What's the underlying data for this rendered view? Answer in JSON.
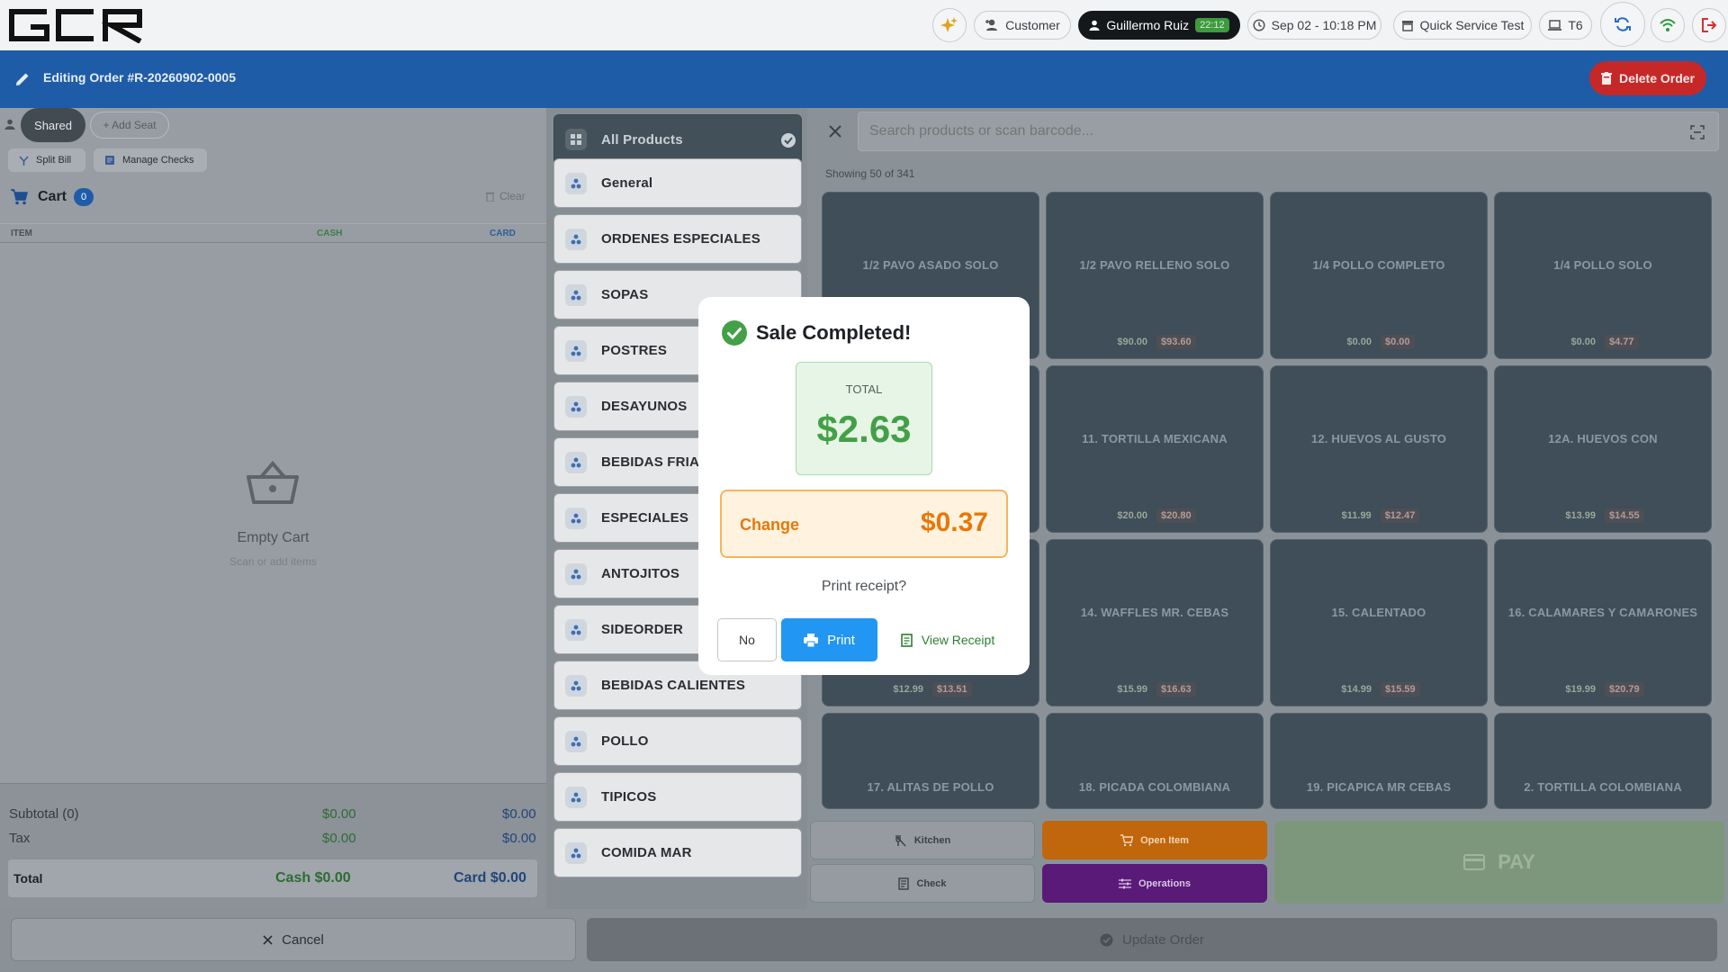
{
  "topbar": {
    "logo": "GCR",
    "customer_label": "Customer",
    "user_name": "Guillermo Ruiz",
    "user_timer": "22:12",
    "datetime": "Sep 02 - 10:18 PM",
    "store": "Quick Service Test",
    "table": "T6"
  },
  "editbar": {
    "title": "Editing Order #R-20260902-0005",
    "delete_label": "Delete Order"
  },
  "seats": {
    "shared_label": "Shared",
    "add_seat_label": "+ Add Seat",
    "split_bill_label": "Split Bill",
    "manage_checks_label": "Manage Checks"
  },
  "cart": {
    "title": "Cart",
    "count": "0",
    "clear_label": "Clear",
    "col_item": "ITEM",
    "col_cash": "CASH",
    "col_card": "CARD",
    "empty_title": "Empty Cart",
    "empty_subtitle": "Scan or add items",
    "subtotal_label": "Subtotal (0)",
    "subtotal_cash": "$0.00",
    "subtotal_card": "$0.00",
    "tax_label": "Tax",
    "tax_cash": "$0.00",
    "tax_card": "$0.00",
    "total_label": "Total",
    "total_cash": "Cash $0.00",
    "total_card": "Card $0.00"
  },
  "categories": [
    {
      "label": "All Products"
    },
    {
      "label": "General"
    },
    {
      "label": "ORDENES ESPECIALES"
    },
    {
      "label": "SOPAS"
    },
    {
      "label": "POSTRES"
    },
    {
      "label": "DESAYUNOS"
    },
    {
      "label": "BEBIDAS FRIAS"
    },
    {
      "label": "ESPECIALES"
    },
    {
      "label": "ANTOJITOS"
    },
    {
      "label": "SIDEORDER"
    },
    {
      "label": "BEBIDAS CALIENTES"
    },
    {
      "label": "POLLO"
    },
    {
      "label": "TIPICOS"
    },
    {
      "label": "COMIDA MAR"
    }
  ],
  "search": {
    "placeholder": "Search products or scan barcode...",
    "showing": "Showing 50 of 341"
  },
  "products": [
    {
      "name": "1/2 PAVO ASADO SOLO",
      "cash": "",
      "card": ""
    },
    {
      "name": "1/2 PAVO RELLENO SOLO",
      "cash": "$90.00",
      "card": "$93.60"
    },
    {
      "name": "1/4 POLLO COMPLETO",
      "cash": "$0.00",
      "card": "$0.00"
    },
    {
      "name": "1/4 POLLO SOLO",
      "cash": "$0.00",
      "card": "$4.77"
    },
    {
      "name": "",
      "cash": "",
      "card": ""
    },
    {
      "name": "11. TORTILLA MEXICANA",
      "cash": "$20.00",
      "card": "$20.80"
    },
    {
      "name": "12. HUEVOS AL GUSTO",
      "cash": "$11.99",
      "card": "$12.47"
    },
    {
      "name": "12A. HUEVOS CON",
      "cash": "$13.99",
      "card": "$14.55"
    },
    {
      "name": "",
      "cash": "$12.99",
      "card": "$13.51"
    },
    {
      "name": "14. WAFFLES  MR. CEBAS",
      "cash": "$15.99",
      "card": "$16.63"
    },
    {
      "name": "15. CALENTADO",
      "cash": "$14.99",
      "card": "$15.59"
    },
    {
      "name": "16. CALAMARES Y CAMARONES",
      "cash": "$19.99",
      "card": "$20.79"
    },
    {
      "name": "17. ALITAS  DE POLLO",
      "cash": "",
      "card": ""
    },
    {
      "name": "18. PICADA COLOMBIANA",
      "cash": "",
      "card": ""
    },
    {
      "name": "19. PICAPICA MR CEBAS",
      "cash": "",
      "card": ""
    },
    {
      "name": "2. TORTILLA COLOMBIANA",
      "cash": "",
      "card": ""
    }
  ],
  "actions": {
    "kitchen": "Kitchen",
    "open_item": "Open Item",
    "check": "Check",
    "operations": "Operations",
    "pay": "PAY"
  },
  "footer": {
    "cancel": "Cancel",
    "update": "Update Order"
  },
  "modal": {
    "title": "Sale Completed!",
    "total_label": "TOTAL",
    "total_value": "$2.63",
    "change_label": "Change",
    "change_value": "$0.37",
    "question": "Print receipt?",
    "no_label": "No",
    "print_label": "Print",
    "view_label": "View Receipt"
  },
  "colors": {
    "header_blue": "#1e5ca8",
    "delete_red": "#c62828",
    "success_green": "#43a047",
    "change_orange": "#e8770a",
    "print_blue": "#2196f3",
    "open_item_orange": "#c0660c",
    "operations_purple": "#5a1a78"
  }
}
